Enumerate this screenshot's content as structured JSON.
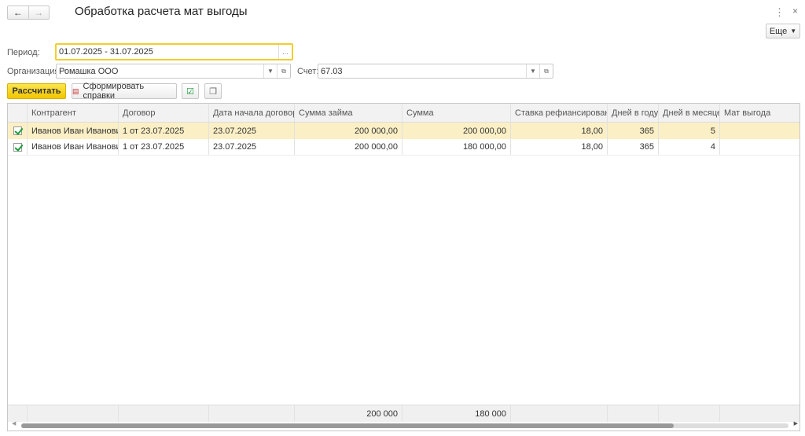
{
  "window": {
    "title": "Обработка расчета мат выгоды",
    "back": "←",
    "forward": "→",
    "menu": "⋮",
    "close": "×",
    "more": "Еще"
  },
  "form": {
    "period_label": "Период:",
    "period_value": "01.07.2025 - 31.07.2025",
    "org_label": "Организация:",
    "org_value": "Ромашка ООО",
    "account_label": "Счет:",
    "account_value": "67.03"
  },
  "toolbar": {
    "calculate": "Рассчитать",
    "make_reports": "Сформировать справки"
  },
  "table": {
    "columns": [
      "",
      "Контрагент",
      "Договор",
      "Дата начала договора",
      "Сумма займа",
      "Сумма",
      "Ставка рефиансирования",
      "Дней в году",
      "Дней в месяце",
      "Мат выгода"
    ],
    "rows": [
      {
        "checked": true,
        "counterparty": "Иванов Иван Иванович",
        "contract": "1 от 23.07.2025",
        "start": "23.07.2025",
        "loan": "200 000,00",
        "sum": "200 000,00",
        "rate": "18,00",
        "days_year": "365",
        "days_month": "5",
        "benefit": ""
      },
      {
        "checked": true,
        "counterparty": "Иванов Иван Иванович",
        "contract": "1 от 23.07.2025",
        "start": "23.07.2025",
        "loan": "200 000,00",
        "sum": "180 000,00",
        "rate": "18,00",
        "days_year": "365",
        "days_month": "4",
        "benefit": ""
      }
    ],
    "totals": {
      "loan": "200 000",
      "sum": "180 000"
    },
    "scroll_fraction": 0.85
  }
}
